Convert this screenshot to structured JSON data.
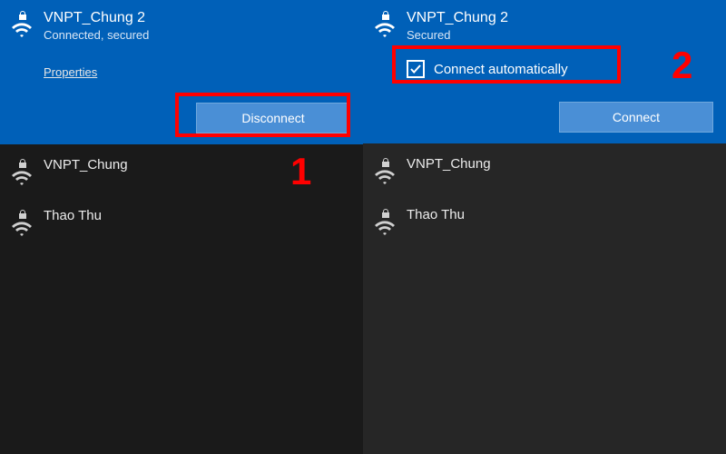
{
  "left": {
    "selected": {
      "ssid": "VNPT_Chung 2",
      "status": "Connected, secured",
      "properties_label": "Properties",
      "button_label": "Disconnect"
    },
    "networks": [
      {
        "ssid": "VNPT_Chung",
        "secured": true
      },
      {
        "ssid": "Thao Thu",
        "secured": true
      }
    ],
    "annotation_label": "1"
  },
  "right": {
    "selected": {
      "ssid": "VNPT_Chung 2",
      "status": "Secured",
      "checkbox_label": "Connect automatically",
      "checkbox_checked": true,
      "button_label": "Connect"
    },
    "networks": [
      {
        "ssid": "VNPT_Chung",
        "secured": true
      },
      {
        "ssid": "Thao Thu",
        "secured": true
      }
    ],
    "annotation_label": "2"
  },
  "icons": {
    "wifi": "wifi-icon",
    "lock": "lock-icon",
    "check": "check-icon"
  }
}
